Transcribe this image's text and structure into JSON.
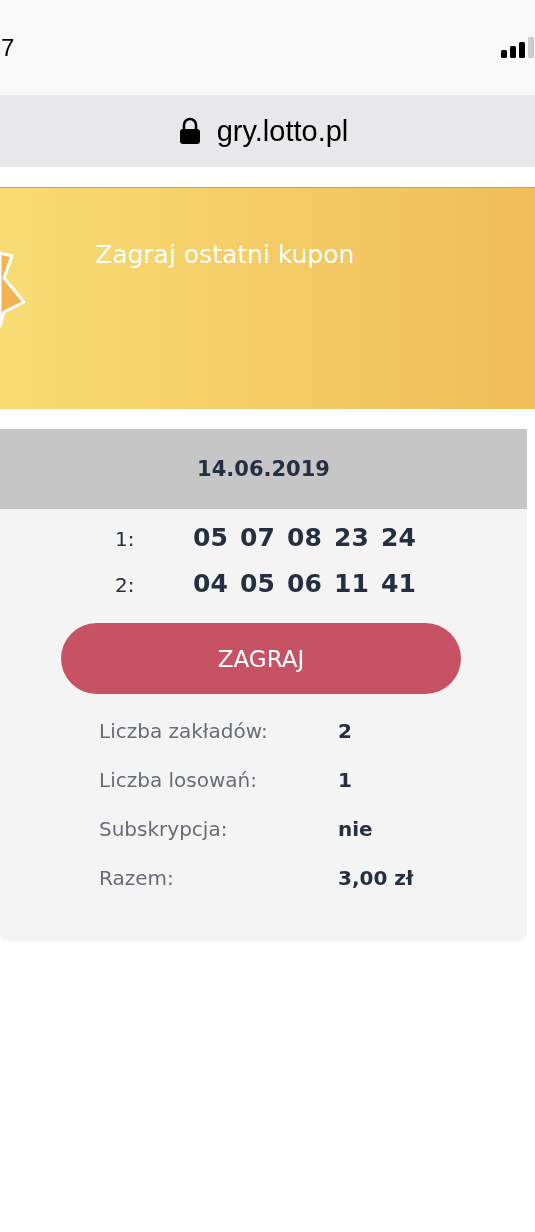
{
  "status_bar": {
    "time": "7"
  },
  "address_bar": {
    "url": "gry.lotto.pl"
  },
  "banner": {
    "title": "Zagraj ostatni kupon"
  },
  "coupon": {
    "date": "14.06.2019",
    "bets": [
      {
        "label": "1:",
        "numbers": [
          "05",
          "07",
          "08",
          "23",
          "24"
        ]
      },
      {
        "label": "2:",
        "numbers": [
          "04",
          "05",
          "06",
          "11",
          "41"
        ]
      }
    ],
    "button": "ZAGRAJ",
    "summary": [
      {
        "label": "Liczba zakładów:",
        "value": "2"
      },
      {
        "label": "Liczba losowań:",
        "value": "1"
      },
      {
        "label": "Subskrypcja:",
        "value": "nie"
      },
      {
        "label": "Razem:",
        "value": "3,00 zł"
      }
    ]
  }
}
